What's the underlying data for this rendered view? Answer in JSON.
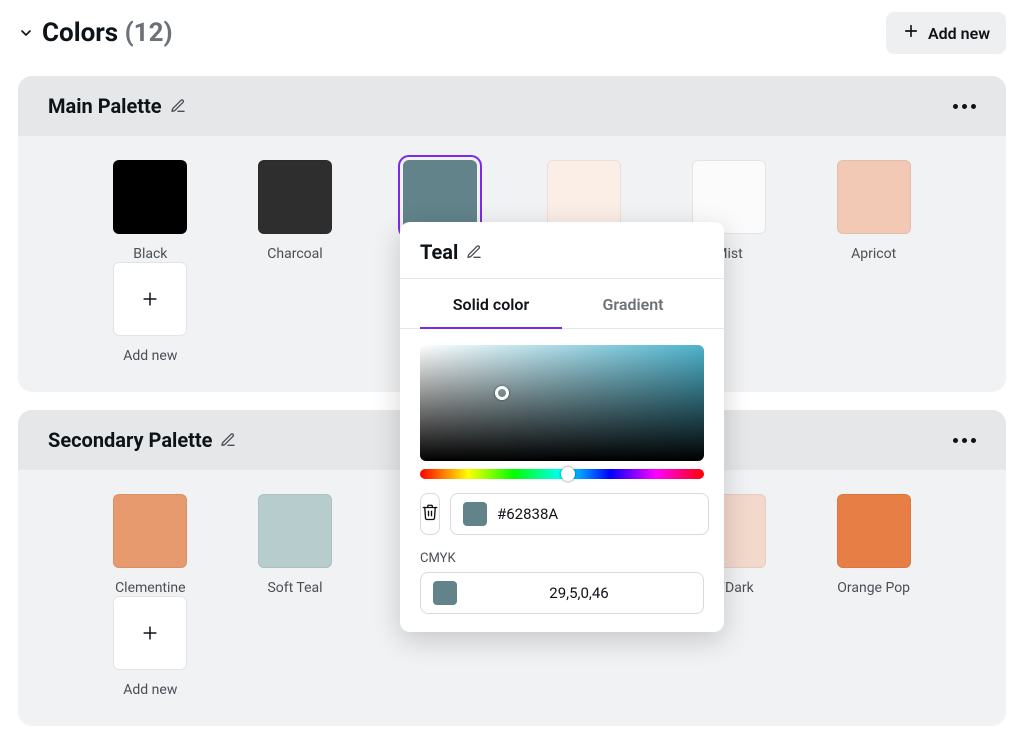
{
  "header": {
    "title": "Colors",
    "count_display": "(12)",
    "add_new_label": "Add new"
  },
  "palettes": [
    {
      "title": "Main Palette",
      "swatches": [
        {
          "name": "Black",
          "hex": "#000000",
          "selected": false
        },
        {
          "name": "Charcoal",
          "hex": "#2e2e2e",
          "selected": false
        },
        {
          "name": "Teal",
          "hex": "#62838a",
          "selected": true
        },
        {
          "name": "",
          "hex": "#faeee7",
          "selected": false
        },
        {
          "name": "Mist",
          "hex": "#fcfbfc",
          "selected": false
        },
        {
          "name": "Apricot",
          "hex": "#f1c9b5",
          "selected": false
        }
      ],
      "add_label": "Add new"
    },
    {
      "title": "Secondary Palette",
      "swatches": [
        {
          "name": "Clementine",
          "hex": "#e79a6e",
          "selected": false
        },
        {
          "name": "Soft Teal",
          "hex": "#b7cccd",
          "selected": false
        },
        {
          "name": "",
          "hex": "#ffffff",
          "selected": false,
          "hidden": true
        },
        {
          "name": "",
          "hex": "#ffffff",
          "selected": false,
          "hidden": true
        },
        {
          "name": "sh/Dark",
          "hex": "#f3d9cc",
          "selected": false
        },
        {
          "name": "Orange Pop",
          "hex": "#e67e46",
          "selected": false
        }
      ],
      "add_label": "Add new"
    }
  ],
  "color_popover": {
    "title": "Teal",
    "tabs": {
      "solid": "Solid color",
      "gradient": "Gradient"
    },
    "active_tab": "solid",
    "hex": "#62838A",
    "swatch_hex": "#62838a",
    "cmyk_label": "CMYK",
    "cmyk_value": "29,5,0,46"
  }
}
